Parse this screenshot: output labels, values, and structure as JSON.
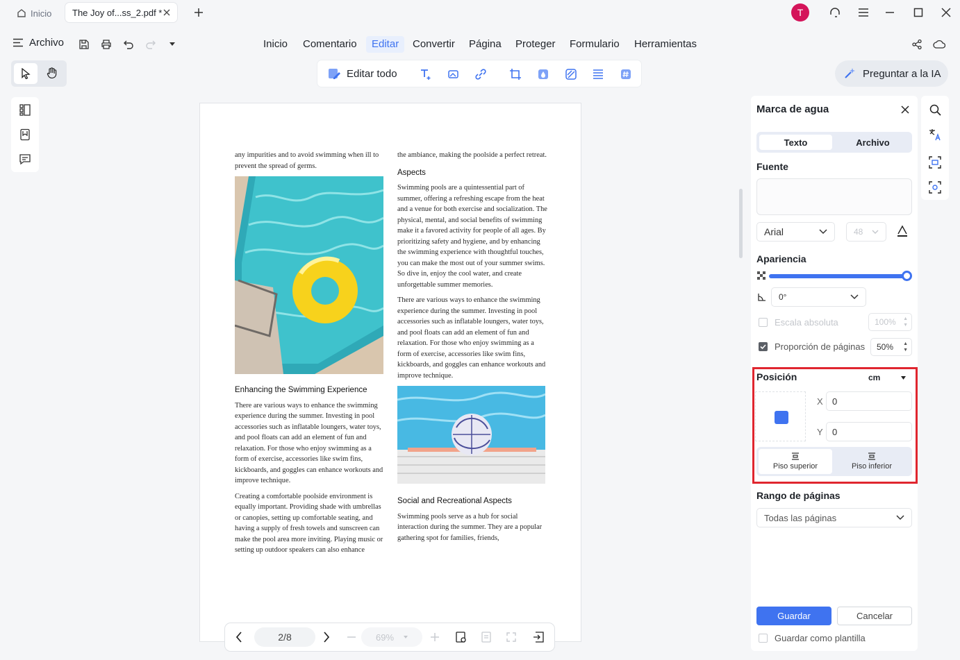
{
  "titlebar": {
    "home_tab": "Inicio",
    "doc_tab": "The Joy of...ss_2.pdf *",
    "avatar_letter": "T"
  },
  "menubar": {
    "archivo": "Archivo",
    "items": [
      "Inicio",
      "Comentario",
      "Editar",
      "Convertir",
      "Página",
      "Proteger",
      "Formulario",
      "Herramientas"
    ],
    "active": "Editar"
  },
  "toolbar": {
    "edit_all": "Editar todo",
    "ai_button": "Preguntar a la IA"
  },
  "document": {
    "left_col": {
      "p1": "any impurities and to avoid swimming when ill to prevent the spread of germs.",
      "h1": "Enhancing the Swimming Experience",
      "p2": "There are various ways to enhance the swimming experience during the summer. Investing in pool accessories such as inflatable loungers, water toys, and pool floats can add an element of fun and relaxation. For those who enjoy swimming as a form of exercise, accessories like swim fins, kickboards, and goggles can enhance workouts and improve technique.",
      "p3": "Creating a comfortable poolside environment is equally important. Providing shade with umbrellas or canopies, setting up comfortable seating, and having a supply of fresh towels and sunscreen can make the pool area more inviting. Playing music or setting up outdoor speakers can also enhance"
    },
    "right_col": {
      "p1": "the ambiance, making the poolside a perfect retreat.",
      "h1": "Aspects",
      "p2": "Swimming pools are a quintessential part of summer, offering a refreshing escape from the heat and a venue for both exercise and socialization. The physical, mental, and social benefits of swimming make it a favored activity for people of all ages. By prioritizing safety and hygiene, and by enhancing the swimming experience with thoughtful touches, you can make the most out of your summer swims. So dive in, enjoy the cool water, and create unforgettable summer memories.",
      "p3": "There are various ways to enhance the swimming experience during the summer. Investing in pool accessories such as inflatable loungers, water toys, and pool floats can add an element of fun and relaxation. For those who enjoy swimming as a form of exercise, accessories like swim fins, kickboards, and goggles can enhance workouts and improve technique.",
      "h2": "Social and Recreational Aspects",
      "p4": "Swimming pools serve as a hub for social interaction during the summer. They are a popular gathering spot for families, friends,"
    }
  },
  "nav": {
    "page": "2/8",
    "zoom": "69%"
  },
  "panel": {
    "title": "Marca de agua",
    "tab_text": "Texto",
    "tab_file": "Archivo",
    "font_section": "Fuente",
    "font_name": "Arial",
    "font_size": "48",
    "appearance_section": "Apariencia",
    "rotation": "0°",
    "absolute_scale_label": "Escala absoluta",
    "absolute_scale_value": "100%",
    "page_ratio_label": "Proporción de páginas",
    "page_ratio_value": "50%",
    "position_section": "Posición",
    "unit": "cm",
    "x_label": "X",
    "x_value": "0",
    "y_label": "Y",
    "y_value": "0",
    "layer_top": "Piso superior",
    "layer_bottom": "Piso inferior",
    "range_section": "Rango de páginas",
    "range_value": "Todas las páginas",
    "save": "Guardar",
    "cancel": "Cancelar",
    "save_template": "Guardar como plantilla"
  },
  "colors": {
    "accent": "#3f73f0",
    "highlight_box": "#e0262f",
    "avatar": "#d4145a"
  }
}
